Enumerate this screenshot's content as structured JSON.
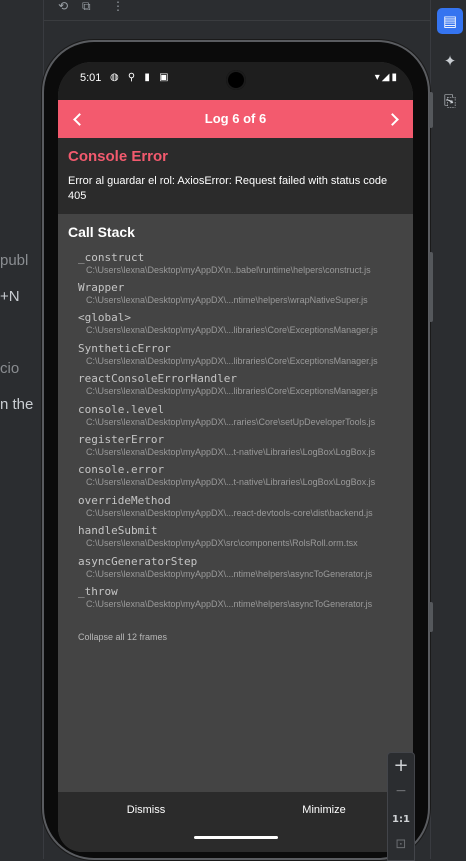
{
  "bg": {
    "left_texts": [
      "publ",
      "+N",
      "cio",
      "n the"
    ]
  },
  "phone": {
    "status": {
      "time": "5:01",
      "left_icons": "◍ ⚲ ▮ ▣",
      "right_icons": "▾◢▮"
    },
    "header": {
      "title": "Log 6 of 6"
    },
    "error": {
      "title": "Console Error",
      "message": "Error al guardar el rol: AxiosError: Request failed with status code 405"
    },
    "call_stack": {
      "title": "Call Stack",
      "frames": [
        {
          "fn": "_construct",
          "path": "C:\\Users\\lexna\\Desktop\\myAppDX\\n..babel\\runtime\\helpers\\construct.js"
        },
        {
          "fn": "Wrapper",
          "path": "C:\\Users\\lexna\\Desktop\\myAppDX\\...ntime\\helpers\\wrapNativeSuper.js"
        },
        {
          "fn": "<global>",
          "path": "C:\\Users\\lexna\\Desktop\\myAppDX\\...libraries\\Core\\ExceptionsManager.js"
        },
        {
          "fn": "SyntheticError",
          "path": "C:\\Users\\lexna\\Desktop\\myAppDX\\...libraries\\Core\\ExceptionsManager.js"
        },
        {
          "fn": "reactConsoleErrorHandler",
          "path": "C:\\Users\\lexna\\Desktop\\myAppDX\\...libraries\\Core\\ExceptionsManager.js"
        },
        {
          "fn": "console.level",
          "path": "C:\\Users\\lexna\\Desktop\\myAppDX\\...raries\\Core\\setUpDeveloperTools.js"
        },
        {
          "fn": "registerError",
          "path": "C:\\Users\\lexna\\Desktop\\myAppDX\\...t-native\\Libraries\\LogBox\\LogBox.js"
        },
        {
          "fn": "console.error",
          "path": "C:\\Users\\lexna\\Desktop\\myAppDX\\...t-native\\Libraries\\LogBox\\LogBox.js"
        },
        {
          "fn": "overrideMethod",
          "path": "C:\\Users\\lexna\\Desktop\\myAppDX\\...react-devtools-core\\dist\\backend.js"
        },
        {
          "fn": "handleSubmit",
          "path": "C:\\Users\\lexna\\Desktop\\myAppDX\\src\\components\\RolsRoll.orm.tsx"
        },
        {
          "fn": "asyncGeneratorStep",
          "path": "C:\\Users\\lexna\\Desktop\\myAppDX\\...ntime\\helpers\\asyncToGenerator.js"
        },
        {
          "fn": "_throw",
          "path": "C:\\Users\\lexna\\Desktop\\myAppDX\\...ntime\\helpers\\asyncToGenerator.js"
        }
      ],
      "collapse_label": "Collapse all 12 frames"
    },
    "bottom": {
      "dismiss": "Dismiss",
      "minimize": "Minimize"
    }
  },
  "zoom": {
    "plus": "+",
    "minus": "−",
    "ratio": "1:1",
    "fit": "⊡"
  }
}
